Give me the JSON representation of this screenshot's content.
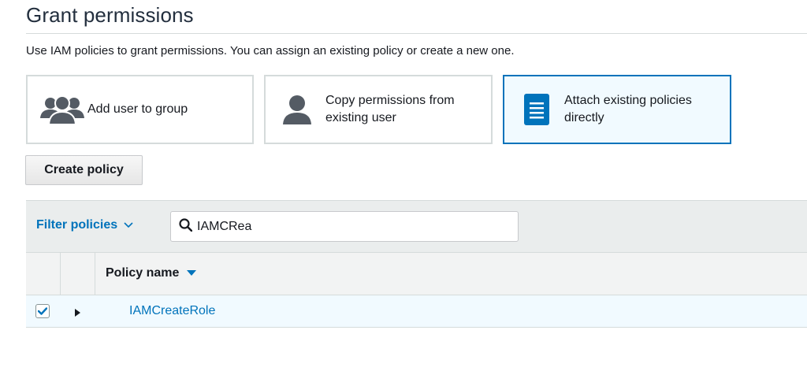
{
  "header": {
    "title": "Grant permissions",
    "subtitle": "Use IAM policies to grant permissions. You can assign an existing policy or create a new one."
  },
  "options": [
    {
      "label": "Add user to group",
      "icon": "users-group-icon"
    },
    {
      "label_line1": "Copy permissions from",
      "label_line2": "existing user",
      "icon": "user-icon"
    },
    {
      "label_line1": "Attach existing policies",
      "label_line2": "directly",
      "icon": "document-icon",
      "selected": true
    }
  ],
  "toolbar": {
    "create_policy_label": "Create policy"
  },
  "filter": {
    "dropdown_label": "Filter policies",
    "search_value": "IAMCRea"
  },
  "table": {
    "columns": [
      "Policy name"
    ],
    "rows": [
      {
        "name": "IAMCreateRole",
        "checked": true
      }
    ]
  },
  "colors": {
    "accent": "#0073bb",
    "selected_bg": "#f1faff",
    "icon_gray": "#545b64"
  }
}
